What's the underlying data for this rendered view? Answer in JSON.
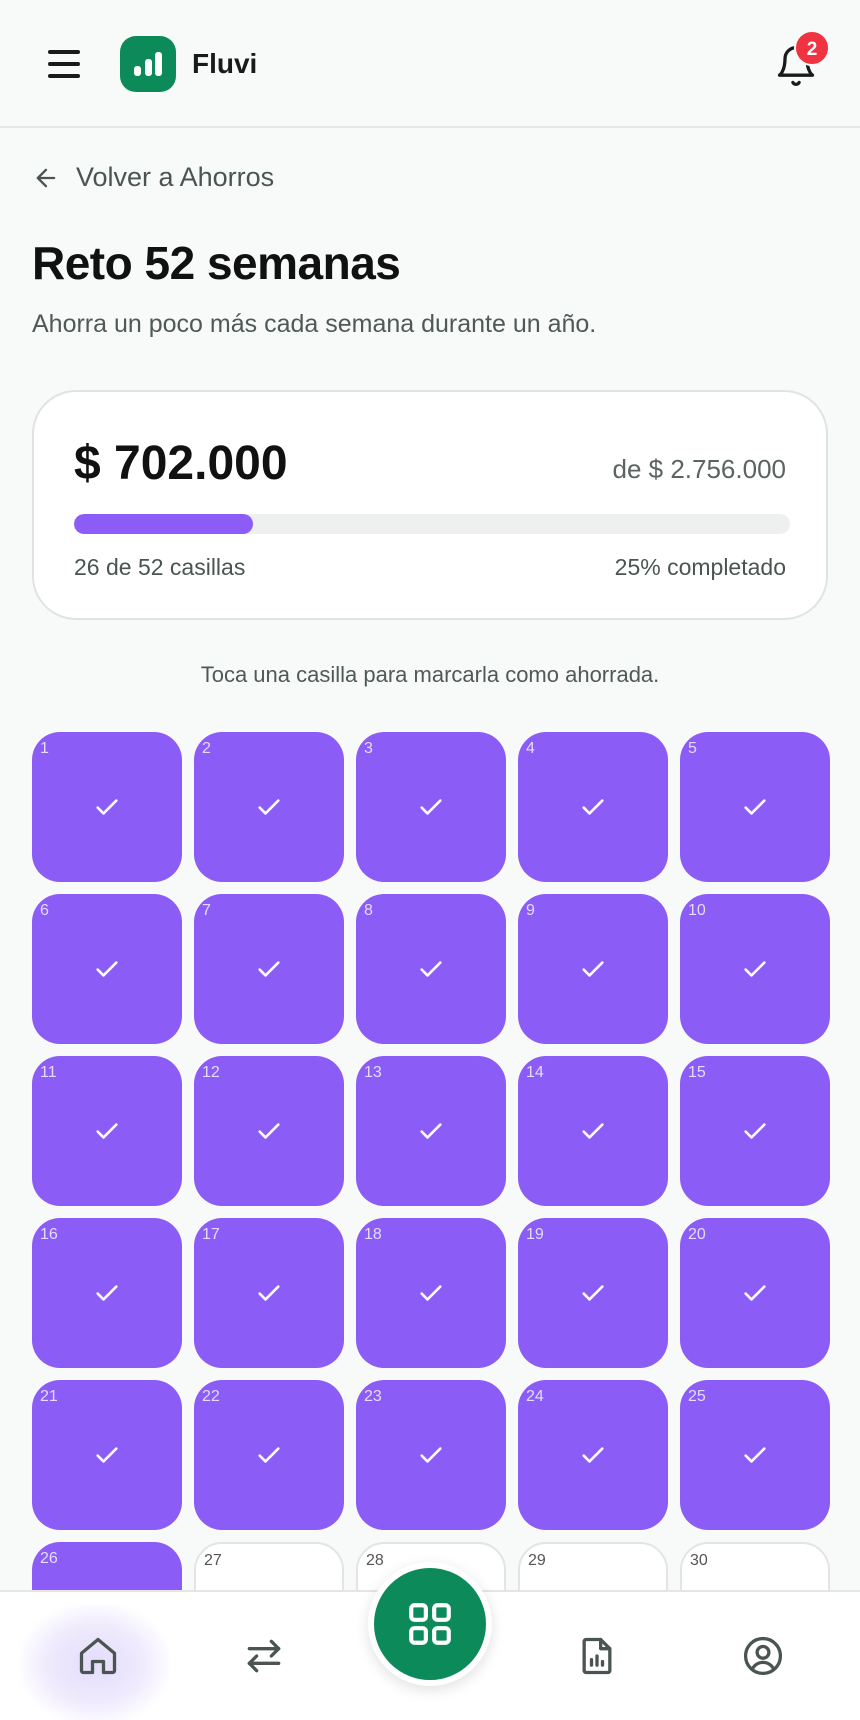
{
  "header": {
    "app_name": "Fluvi",
    "notification_count": "2",
    "brand_color": "#0c8a5a"
  },
  "back_link": {
    "label": "Volver a Ahorros"
  },
  "page": {
    "title": "Reto 52 semanas",
    "subtitle": "Ahorra un poco más cada semana durante un año."
  },
  "progress": {
    "amount": "$ 702.000",
    "goal": "de $ 2.756.000",
    "boxes_label": "26 de 52 casillas",
    "percent_label": "25% completado",
    "fill_fraction": 0.25,
    "accent_color": "#8b5cf6"
  },
  "hint": "Toca una casilla para marcarla como ahorrada.",
  "weeks": [
    {
      "n": "1",
      "done": true
    },
    {
      "n": "2",
      "done": true
    },
    {
      "n": "3",
      "done": true
    },
    {
      "n": "4",
      "done": true
    },
    {
      "n": "5",
      "done": true
    },
    {
      "n": "6",
      "done": true
    },
    {
      "n": "7",
      "done": true
    },
    {
      "n": "8",
      "done": true
    },
    {
      "n": "9",
      "done": true
    },
    {
      "n": "10",
      "done": true
    },
    {
      "n": "11",
      "done": true
    },
    {
      "n": "12",
      "done": true
    },
    {
      "n": "13",
      "done": true
    },
    {
      "n": "14",
      "done": true
    },
    {
      "n": "15",
      "done": true
    },
    {
      "n": "16",
      "done": true
    },
    {
      "n": "17",
      "done": true
    },
    {
      "n": "18",
      "done": true
    },
    {
      "n": "19",
      "done": true
    },
    {
      "n": "20",
      "done": true
    },
    {
      "n": "21",
      "done": true
    },
    {
      "n": "22",
      "done": true
    },
    {
      "n": "23",
      "done": true
    },
    {
      "n": "24",
      "done": true
    },
    {
      "n": "25",
      "done": true
    },
    {
      "n": "26",
      "done": true
    },
    {
      "n": "27",
      "done": false
    },
    {
      "n": "28",
      "done": false
    },
    {
      "n": "29",
      "done": false
    },
    {
      "n": "30",
      "done": false
    }
  ],
  "nav": {
    "items": [
      {
        "icon": "home-icon",
        "active": true
      },
      {
        "icon": "transfer-icon",
        "active": false
      },
      {
        "icon": "grid-icon",
        "active": false
      },
      {
        "icon": "report-icon",
        "active": false
      },
      {
        "icon": "profile-icon",
        "active": false
      }
    ]
  }
}
